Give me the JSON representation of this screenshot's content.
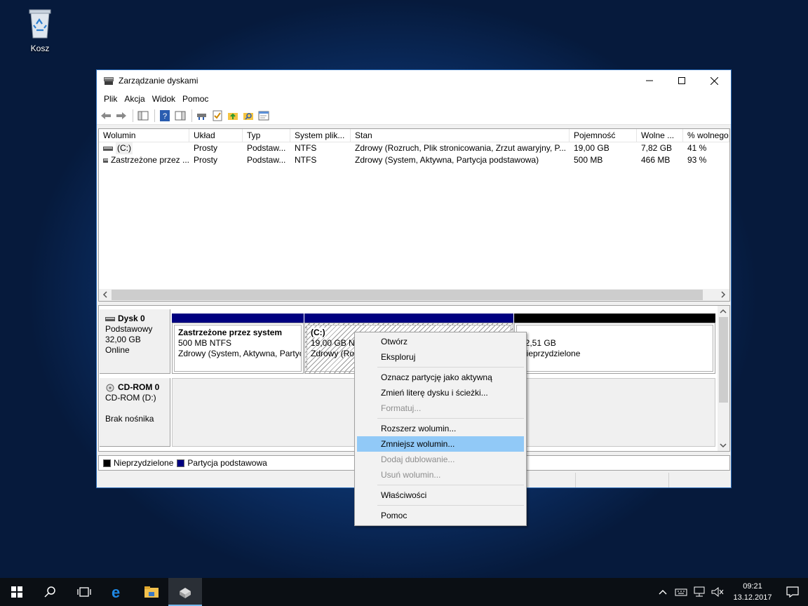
{
  "desktop": {
    "recycle_bin_label": "Kosz"
  },
  "window": {
    "title": "Zarządzanie dyskami",
    "menu": [
      "Plik",
      "Akcja",
      "Widok",
      "Pomoc"
    ]
  },
  "volumes": {
    "columns": [
      "Wolumin",
      "Układ",
      "Typ",
      "System plik...",
      "Stan",
      "Pojemność",
      "Wolne ...",
      "% wolnego"
    ],
    "rows": [
      [
        "(C:)",
        "Prosty",
        "Podstaw...",
        "NTFS",
        "Zdrowy (Rozruch, Plik stronicowania, Zrzut awaryjny, P...",
        "19,00 GB",
        "7,82 GB",
        "41 %"
      ],
      [
        "Zastrzeżone przez ...",
        "Prosty",
        "Podstaw...",
        "NTFS",
        "Zdrowy (System, Aktywna, Partycja podstawowa)",
        "500 MB",
        "466 MB",
        "93 %"
      ]
    ]
  },
  "disk0": {
    "name": "Dysk 0",
    "type": "Podstawowy",
    "size": "32,00 GB",
    "status": "Online",
    "partitions": [
      {
        "title": "Zastrzeżone przez system",
        "size": "500 MB NTFS",
        "state": "Zdrowy (System, Aktywna, Partycja podstawowa)"
      },
      {
        "title": "(C:)",
        "size": "19,00 GB NTFS",
        "state": "Zdrowy (Rozruch, Plik stronicowania, Zrzut awaryjny, Partycja podstawowa)"
      },
      {
        "size": "12,51 GB",
        "state": "Nieprzydzielone"
      }
    ]
  },
  "cdrom0": {
    "name": "CD-ROM 0",
    "drive": "CD-ROM (D:)",
    "status": "Brak nośnika"
  },
  "legend": {
    "unallocated": "Nieprzydzielone",
    "primary": "Partycja podstawowa"
  },
  "colors": {
    "primary": "#000080",
    "unallocated": "#000000",
    "highlight": "#91c9f7"
  },
  "context_menu": {
    "open": "Otwórz",
    "explore": "Eksploruj",
    "mark_active": "Oznacz partycję jako aktywną",
    "change_letter": "Zmień literę dysku i ścieżki...",
    "format": "Formatuj...",
    "extend": "Rozszerz wolumin...",
    "shrink": "Zmniejsz wolumin...",
    "add_mirror": "Dodaj dublowanie...",
    "delete": "Usuń wolumin...",
    "properties": "Właściwości",
    "help": "Pomoc"
  },
  "taskbar": {
    "time": "09:21",
    "date": "13.12.2017"
  }
}
